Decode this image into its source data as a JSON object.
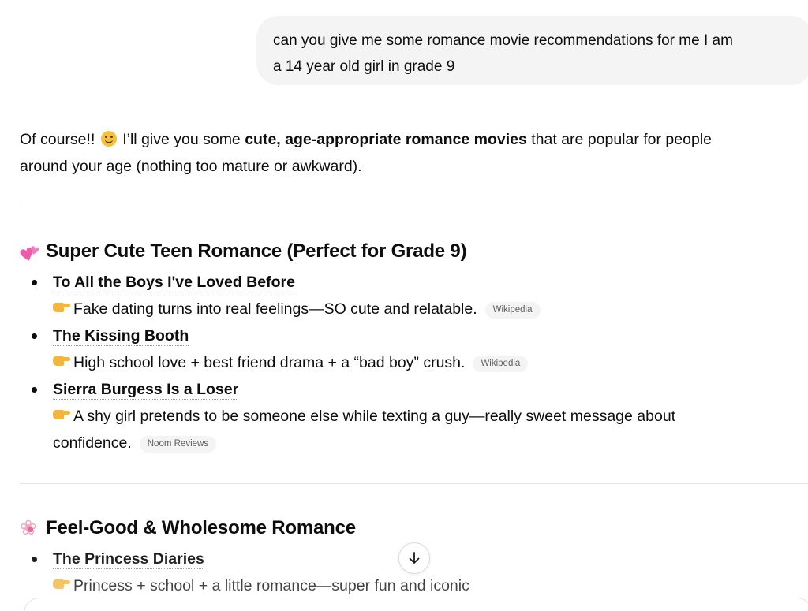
{
  "user_message": {
    "line1": "can you give me some romance movie recommendations for me I am",
    "line2": "a 14 year old girl in grade 9"
  },
  "assistant": {
    "intro": {
      "part1": "Of course!!",
      "emoji": "smiling-face-icon",
      "part2": " I’ll give you some ",
      "bold": "cute, age-appropriate romance movies",
      "part3": " that are popular for people",
      "line2": "around your age (nothing too mature or awkward)."
    },
    "sections": [
      {
        "icon": "two-hearts-icon",
        "heading": "Super Cute Teen Romance (Perfect for Grade 9)",
        "items": [
          {
            "title": "To All the Boys I've Loved Before",
            "icon": "pointing-hand-icon",
            "description": "Fake dating turns into real feelings—SO cute and relatable.",
            "source": "Wikipedia"
          },
          {
            "title": "The Kissing Booth",
            "icon": "pointing-hand-icon",
            "description": "High school love + best friend drama + a “bad boy” crush.",
            "source": "Wikipedia"
          },
          {
            "title": "Sierra Burgess Is a Loser",
            "icon": "pointing-hand-icon",
            "description": "A shy girl pretends to be someone else while texting a guy—really sweet message about",
            "description_cont": "confidence.",
            "source": "Noom Reviews"
          }
        ]
      },
      {
        "icon": "cherry-blossom-icon",
        "heading": "Feel-Good & Wholesome Romance",
        "items": [
          {
            "title": "The Princess Diaries",
            "icon": "pointing-hand-icon",
            "description": "Princess + school + a little romance—super fun and iconic"
          }
        ]
      }
    ]
  },
  "scroll_button": {
    "icon": "arrow-down-icon"
  },
  "colors": {
    "user_bubble_bg": "#f4f4f4",
    "chip_bg": "#f4f4f4",
    "divider": "#e3e3e3",
    "text": "#0d0d0d"
  }
}
